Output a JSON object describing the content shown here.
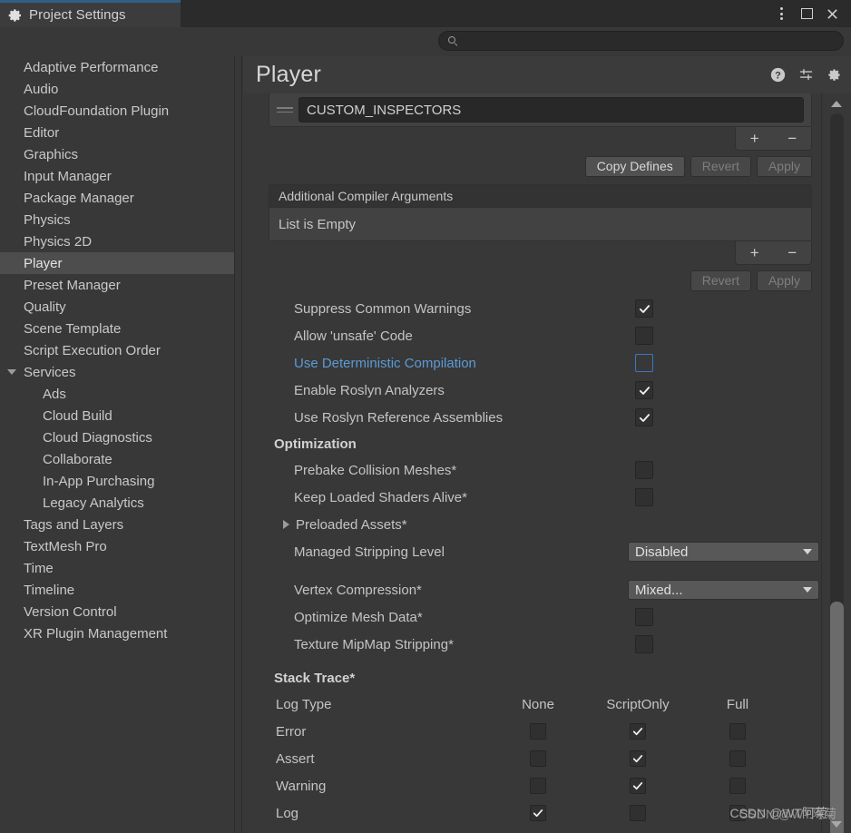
{
  "window": {
    "tab_title": "Project Settings",
    "tab_icon": "gear-icon",
    "controls": {
      "menu": "more-vertical-icon",
      "maximize": "maximize-icon",
      "close": "close-icon"
    }
  },
  "search": {
    "placeholder": "",
    "value": "",
    "icon": "search-icon"
  },
  "sidebar": {
    "items": [
      {
        "label": "Adaptive Performance",
        "level": 0,
        "selected": false
      },
      {
        "label": "Audio",
        "level": 0,
        "selected": false
      },
      {
        "label": "CloudFoundation Plugin",
        "level": 0,
        "selected": false
      },
      {
        "label": "Editor",
        "level": 0,
        "selected": false
      },
      {
        "label": "Graphics",
        "level": 0,
        "selected": false
      },
      {
        "label": "Input Manager",
        "level": 0,
        "selected": false
      },
      {
        "label": "Package Manager",
        "level": 0,
        "selected": false
      },
      {
        "label": "Physics",
        "level": 0,
        "selected": false
      },
      {
        "label": "Physics 2D",
        "level": 0,
        "selected": false
      },
      {
        "label": "Player",
        "level": 0,
        "selected": true
      },
      {
        "label": "Preset Manager",
        "level": 0,
        "selected": false
      },
      {
        "label": "Quality",
        "level": 0,
        "selected": false
      },
      {
        "label": "Scene Template",
        "level": 0,
        "selected": false
      },
      {
        "label": "Script Execution Order",
        "level": 0,
        "selected": false
      },
      {
        "label": "Services",
        "level": 0,
        "selected": false,
        "expanded": true
      },
      {
        "label": "Ads",
        "level": 1,
        "selected": false
      },
      {
        "label": "Cloud Build",
        "level": 1,
        "selected": false
      },
      {
        "label": "Cloud Diagnostics",
        "level": 1,
        "selected": false
      },
      {
        "label": "Collaborate",
        "level": 1,
        "selected": false
      },
      {
        "label": "In-App Purchasing",
        "level": 1,
        "selected": false
      },
      {
        "label": "Legacy Analytics",
        "level": 1,
        "selected": false
      },
      {
        "label": "Tags and Layers",
        "level": 0,
        "selected": false
      },
      {
        "label": "TextMesh Pro",
        "level": 0,
        "selected": false
      },
      {
        "label": "Time",
        "level": 0,
        "selected": false
      },
      {
        "label": "Timeline",
        "level": 0,
        "selected": false
      },
      {
        "label": "Version Control",
        "level": 0,
        "selected": false
      },
      {
        "label": "XR Plugin Management",
        "level": 0,
        "selected": false
      }
    ]
  },
  "panel": {
    "title": "Player",
    "header_icons": [
      "help-icon",
      "preset-icon",
      "gear-icon"
    ]
  },
  "defines_list": {
    "entry_value": "CUSTOM_INSPECTORS",
    "add_label": "+",
    "remove_label": "−",
    "buttons": [
      {
        "label": "Copy Defines",
        "disabled": false
      },
      {
        "label": "Revert",
        "disabled": true
      },
      {
        "label": "Apply",
        "disabled": true
      }
    ]
  },
  "compiler_args": {
    "title": "Additional Compiler Arguments",
    "empty_text": "List is Empty",
    "add_label": "+",
    "remove_label": "−",
    "buttons": [
      {
        "label": "Revert",
        "disabled": true
      },
      {
        "label": "Apply",
        "disabled": true
      }
    ]
  },
  "compile_options": [
    {
      "label": "Suppress Common Warnings",
      "checked": true,
      "highlight": false
    },
    {
      "label": "Allow 'unsafe' Code",
      "checked": false,
      "highlight": false
    },
    {
      "label": "Use Deterministic Compilation",
      "checked": false,
      "highlight": true
    },
    {
      "label": "Enable Roslyn Analyzers",
      "checked": true,
      "highlight": false
    },
    {
      "label": "Use Roslyn Reference Assemblies",
      "checked": true,
      "highlight": false
    }
  ],
  "optimization": {
    "title": "Optimization",
    "rows": [
      {
        "type": "checkbox",
        "label": "Prebake Collision Meshes*",
        "checked": false
      },
      {
        "type": "checkbox",
        "label": "Keep Loaded Shaders Alive*",
        "checked": false
      },
      {
        "type": "foldout",
        "label": "Preloaded Assets*",
        "expanded": false
      },
      {
        "type": "dropdown",
        "label": "Managed Stripping Level",
        "value": "Disabled"
      },
      {
        "type": "spacer"
      },
      {
        "type": "dropdown",
        "label": "Vertex Compression*",
        "value": "Mixed..."
      },
      {
        "type": "checkbox",
        "label": "Optimize Mesh Data*",
        "checked": false
      },
      {
        "type": "checkbox",
        "label": "Texture MipMap Stripping*",
        "checked": false
      }
    ]
  },
  "stack_trace": {
    "title": "Stack Trace*",
    "columns": [
      "Log Type",
      "None",
      "ScriptOnly",
      "Full"
    ],
    "rows": [
      {
        "label": "Error",
        "None": false,
        "ScriptOnly": true,
        "Full": false
      },
      {
        "label": "Assert",
        "None": false,
        "ScriptOnly": true,
        "Full": false
      },
      {
        "label": "Warning",
        "None": false,
        "ScriptOnly": true,
        "Full": false
      },
      {
        "label": "Log",
        "None": true,
        "ScriptOnly": false,
        "Full": false
      }
    ]
  },
  "watermark": {
    "text": "CSDN @WT阿菊"
  },
  "colors": {
    "background": "#383838",
    "panel": "#3b3b3b",
    "selection": "#4d4d4d",
    "accent_blue": "#5b9bd5",
    "tab_accent": "#2f5f87",
    "field": "#282828"
  }
}
